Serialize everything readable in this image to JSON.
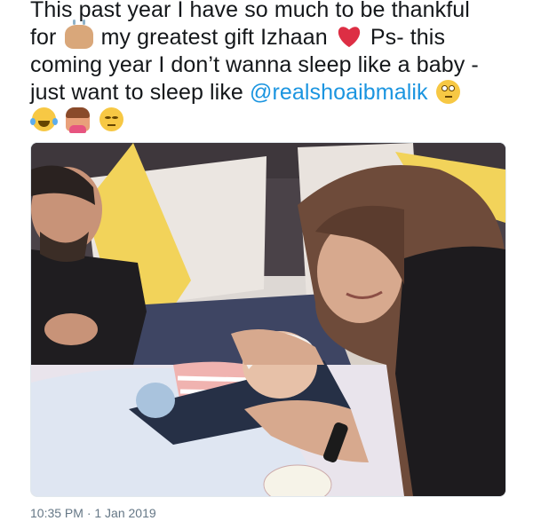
{
  "tweet": {
    "line1": "This past year I have so much to be thankful",
    "line2_a": "for",
    "line2_b": "my greatest gift Izhaan",
    "line2_c": "Ps- this",
    "line3": "coming year I don’t wanna sleep like a baby -",
    "line4_a": "just want to sleep like",
    "mention": "@realshoaibmalik",
    "emojis": [
      "raising-hands-icon",
      "red-heart-icon",
      "face-with-rolling-eyes-icon",
      "tears-of-joy-icon",
      "person-tipping-hand-icon",
      "unamused-face-icon"
    ],
    "mention_color": "#1b95e0"
  },
  "photo": {
    "subject": "family-photo"
  },
  "footer": {
    "timestamp": "10:35 PM · 1 Jan 2019"
  }
}
